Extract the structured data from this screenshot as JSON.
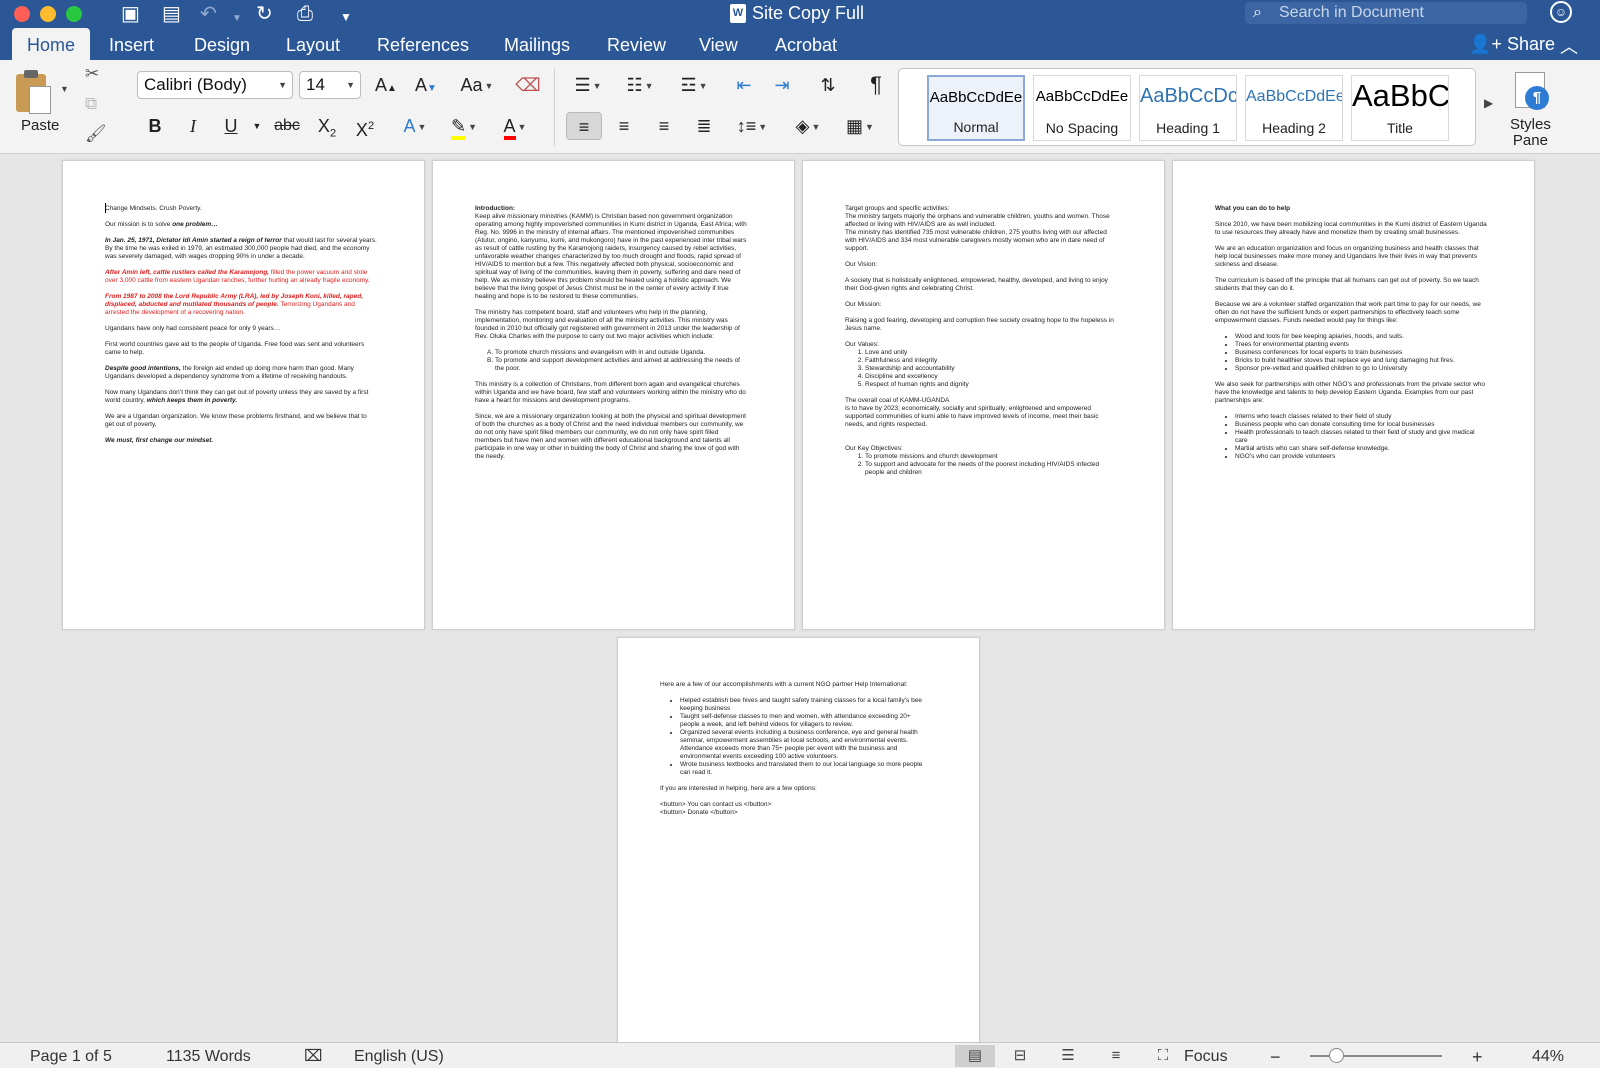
{
  "window": {
    "title": "Site Copy Full",
    "search_placeholder": "Search in Document",
    "share_label": "Share"
  },
  "tabs": [
    "Home",
    "Insert",
    "Design",
    "Layout",
    "References",
    "Mailings",
    "Review",
    "View",
    "Acrobat"
  ],
  "active_tab": "Home",
  "ribbon": {
    "paste_label": "Paste",
    "font_name": "Calibri (Body)",
    "font_size": "14",
    "styles": [
      {
        "sample": "AaBbCcDdEe",
        "name": "Normal"
      },
      {
        "sample": "AaBbCcDdEe",
        "name": "No Spacing"
      },
      {
        "sample": "AaBbCcDc",
        "name": "Heading 1"
      },
      {
        "sample": "AaBbCcDdEe",
        "name": "Heading 2"
      },
      {
        "sample": "AaBbC",
        "name": "Title"
      }
    ],
    "styles_pane_label_1": "Styles",
    "styles_pane_label_2": "Pane",
    "accent_color": "#2b5797",
    "highlight_color": "#ffff00",
    "font_color": "#ff0000"
  },
  "page1": {
    "p1": "Change Mindsets. Crush Poverty.",
    "p2a": "Our mission is to solve ",
    "p2b": "one problem…",
    "p3a": "In Jan. 25, 1971, Dictator Idi Amin started a reign of terror",
    "p3b": " that would last for several years. By the time he was exiled in 1979, an estimated 300,000 people had died, and the economy was severely damaged, with wages dropping 90% in under a decade.",
    "p4a": "After Amin left, cattle rustlers called the Karamojong,",
    "p4b": " filled the power vacuum and stole over 3,000 cattle from eastern Ugandan ranches, further hurting an already fragile economy.",
    "p5a": "From 1987 to 2008 the Lord Republic Army (LRA), led by Joseph Koni, killed, raped, displaced, abducted and mutilated thousands of people.",
    "p5b": " Terrorizing Ugandans and arrested the development of a recovering nation.",
    "p6": "Ugandans have only had consistent peace for only 9 years…",
    "p7": "First world countries gave aid to the people of Uganda. Free food was sent and volunteers came to help.",
    "p8a": "Despite good intentions,",
    "p8b": " the foreign aid ended up doing more harm than good. Many Ugandans developed a dependency syndrome from a lifetime of receiving handouts.",
    "p9a": "Now many Ugandans don’t think they can get out of poverty unless they are saved by a first world country, ",
    "p9b": "which keeps them in poverty.",
    "p10": "We are a Ugandan organization. We know these problems firsthand, and we believe that to get out of poverty,",
    "p11": "We must, first change our mindset."
  },
  "page2": {
    "heading": "Introduction:",
    "p1": "Keep alive missionary ministries (KAMM) is Christian based non government organization operating among highly impoverished communities in Kumi district in Uganda, East Africa; with Reg. No. 9996 in the ministry of internal affairs. The mentioned impoverished communities (Atutur, ongino, kanyumu, kumi, and mukongoro) have in the past experienced inter tribal wars as result of cattle rustling by the Karamojong raiders, insurgency caused by rebel activities, unfavorable weather changes characterized by too much drought and floods, rapid spread of HIV/AIDS to mention but a few. This negatively affected both physical, socioeconomic and spiritual way of living of the communities, leaving them in poverty, suffering and dare need of help. We as ministry believe this problem should be healed using a holistic approach. We believe that the living gospel of Jesus Christ must be in the center of every activity if true healing and hope is to be restored to these communities.",
    "p2": "The ministry has competent board, staff and volunteers who help in the planning, implementation, monitoring and evaluation of all the ministry activities. This ministry was founded in 2010 but officially got registered with government in 2013 under the leadership of Rev. Oluka Charles with the purpose to carry out two major activities which include:",
    "list": [
      "To promote church missions and evangelism with in and outside Uganda.",
      "To promote and support development activities and aimed at addressing the needs of the poor."
    ],
    "p3": "This ministry is a collection of Christians, from different born again and evangelical churches within Uganda and we have board, few staff and volunteers working within the ministry who do have a heart for missions and development programs.",
    "p4": "Since, we are a missionary organization looking at both the physical and spiritual development of both the churches as a body of Christ and the need individual members our community, we do not only have spirit filled members our community, we do not only have spirit filled members but have men and women with different educational background and talents all participate in one way or other in building the body of Christ and sharing the love of god with the needy."
  },
  "page3": {
    "p1": "Target groups and specific activities:",
    "p2": "The ministry targets majorly the orphans and vulnerable children, youths and women.  Those affected or living with HIV/AIDS are as well included.",
    "p3": "The ministry has identified 735 most vulnerable children, 275 youths living with our affected with HIV/AIDS and 334 most vulnerable caregivers mostly women who are in dare need of support.",
    "vision_h": "Our Vision:",
    "vision": "A society that is holistically enlightened, empowered, healthy, developed, and living to enjoy their God-given rights and celebrating Christ.",
    "mission_h": "Our Mission:",
    "mission": "Raising a god fearing, developing and corruption free society creating hope to the hopeless in Jesus name.",
    "values_h": "Our Values:",
    "values": [
      "Love and unity",
      "Faithfulness and integrity",
      "Stewardship and accountability",
      "Discipline and excellency",
      "Respect of human rights and dignity"
    ],
    "goal_h": "The overall coal of KAMM-UGANDA",
    "goal": "Is to have by 2023; economically, socially and spiritually; enlightened and empowered supported communities of kumi able to have improved  levels of income, meet their basic needs, and rights respected.",
    "obj_h": "Our Key Objectives:",
    "objectives": [
      "To promote missions and church development",
      "To support and advocate for the needs of the poorest including HIV/AIDS infected people and children"
    ]
  },
  "page4": {
    "heading": "What you can do to help",
    "p1": "Since 2010, we have been mobilizing local communities in the Kumi district of Eastern Uganda to use resources they already have and monetize them by creating small businesses.",
    "p2": "We are an education organization and focus on organizing business and health classes that help local businesses make more money and Ugandans live their lives in way that prevents sickness and disease.",
    "p3": "The curriculum is based off the principle that all humans can get out of poverty. So we teach students that they can do it.",
    "p4": "Because we are a volunteer staffed organization that work part time to pay for our needs, we often do not have the sufficient funds or expert partnerships to effectively teach some empowerment classes. Funds needed would pay for things like:",
    "list1": [
      "Wood and tools for bee keeping apiaries, hoods, and suits.",
      "Trees for environmental planting events",
      "Business conferences for local experts to train businesses",
      "Bricks to build healthier stoves that replace eye and lung damaging hut fires.",
      "Sponsor pre-vetted  and qualified children to go to University"
    ],
    "p5": "We also seek for partnerships with other NGO’s and professionals from the private sector who have the knowledge and talents to help develop Eastern Uganda. Examples from our past partnerships are:",
    "list2": [
      "Interns who teach classes related to their field of study",
      "Business people who can donate consulting time for local businesses",
      "Health professionals to teach classes related to their field of study and give medical care",
      "Martial artists who can share self-defense knowledge.",
      "NGO’s who can provide volunteers"
    ]
  },
  "page5": {
    "p1": "Here are a few of our accomplishments with a current NGO partner Help International:",
    "list": [
      "Helped establish bee hives and taught safety training classes for a local family’s bee keeping business",
      "Taught self-defense classes to men and women, with attendance exceeding 20+ people a week, and left behind videos for villagers to review.",
      "Organized several events including a business conference, eye and general health seminar, empowerment assemblies at local schools, and environmental events. Attendance exceeds more than 75+ people per event with the business and environmental events exceeding 100 active volunteers.",
      "Wrote business textbooks and translated them to our local language so more people can read it."
    ],
    "p2": "If you are interested in helping, here are a few options:",
    "p3": "<button> You can contact us </button>",
    "p4": "<button> Donate </button>"
  },
  "status": {
    "page": "Page 1 of 5",
    "words": "1135 Words",
    "language": "English (US)",
    "focus": "Focus",
    "zoom": "44%",
    "zoom_fraction": 0.2
  }
}
